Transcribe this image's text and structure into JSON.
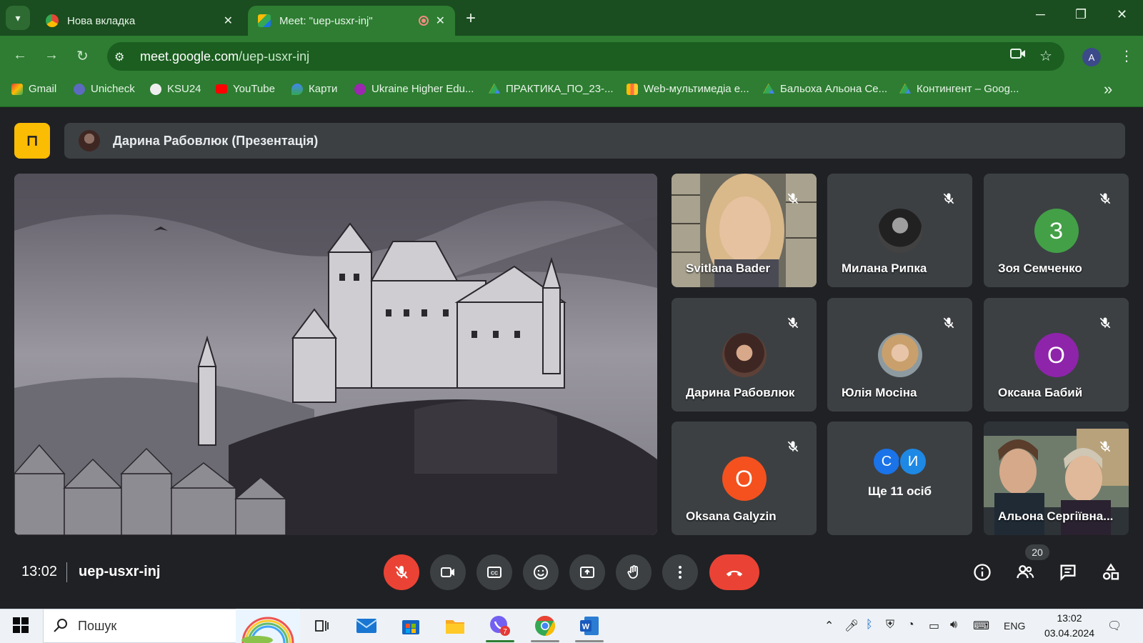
{
  "browser": {
    "tabs": [
      {
        "title": "Нова вкладка",
        "active": false
      },
      {
        "title": "Meet: \"uep-usxr-inj\"",
        "active": true
      }
    ],
    "url_domain": "meet.google.com",
    "url_path": "/uep-usxr-inj",
    "profile_initial": "A",
    "bookmarks": [
      {
        "label": "Gmail",
        "icon": "gmail-icon"
      },
      {
        "label": "Unicheck",
        "icon": "unicheck-icon"
      },
      {
        "label": "KSU24",
        "icon": "ksu24-icon"
      },
      {
        "label": "YouTube",
        "icon": "youtube-icon"
      },
      {
        "label": "Карти",
        "icon": "maps-icon"
      },
      {
        "label": "Ukraine Higher Edu...",
        "icon": "uhe-icon"
      },
      {
        "label": "ПРАКТИКА_ПО_23-...",
        "icon": "drive-icon"
      },
      {
        "label": "Web-мультимедіа е...",
        "icon": "web-icon"
      },
      {
        "label": "Бальоха Альона Се...",
        "icon": "drive-icon"
      },
      {
        "label": "Контингент – Goog...",
        "icon": "drive-icon"
      }
    ]
  },
  "meet": {
    "presenter_label": "Дарина Рабовлюк (Презентація)",
    "participants": [
      {
        "name": "Svitlana Bader",
        "kind": "video"
      },
      {
        "name": "Милана Рипка",
        "kind": "photo"
      },
      {
        "name": "Зоя Семченко",
        "kind": "initial",
        "initial": "З",
        "color": "#43a047"
      },
      {
        "name": "Дарина Рабовлюк",
        "kind": "photo"
      },
      {
        "name": "Юлія Мосіна",
        "kind": "photo"
      },
      {
        "name": "Оксана Бабий",
        "kind": "initial",
        "initial": "О",
        "color": "#8e24aa"
      },
      {
        "name": "Oksana Galyzin",
        "kind": "initial",
        "initial": "O",
        "color": "#f4511e"
      },
      {
        "name": "Ще 11 осіб",
        "kind": "more",
        "initials": [
          "С",
          "И"
        ]
      },
      {
        "name": "Альона Сергіївна...",
        "kind": "video"
      }
    ],
    "time": "13:02",
    "meeting_code": "uep-usxr-inj",
    "people_count": "20"
  },
  "taskbar": {
    "search_placeholder": "Пошук",
    "viber_badge": "7",
    "language": "ENG",
    "time": "13:02",
    "date": "03.04.2024"
  },
  "colors": {
    "chrome_green": "#2e7d32",
    "meet_bg": "#202124",
    "tile_bg": "#3c4043",
    "end_red": "#ea4335",
    "pin_yellow": "#fbbc04"
  }
}
